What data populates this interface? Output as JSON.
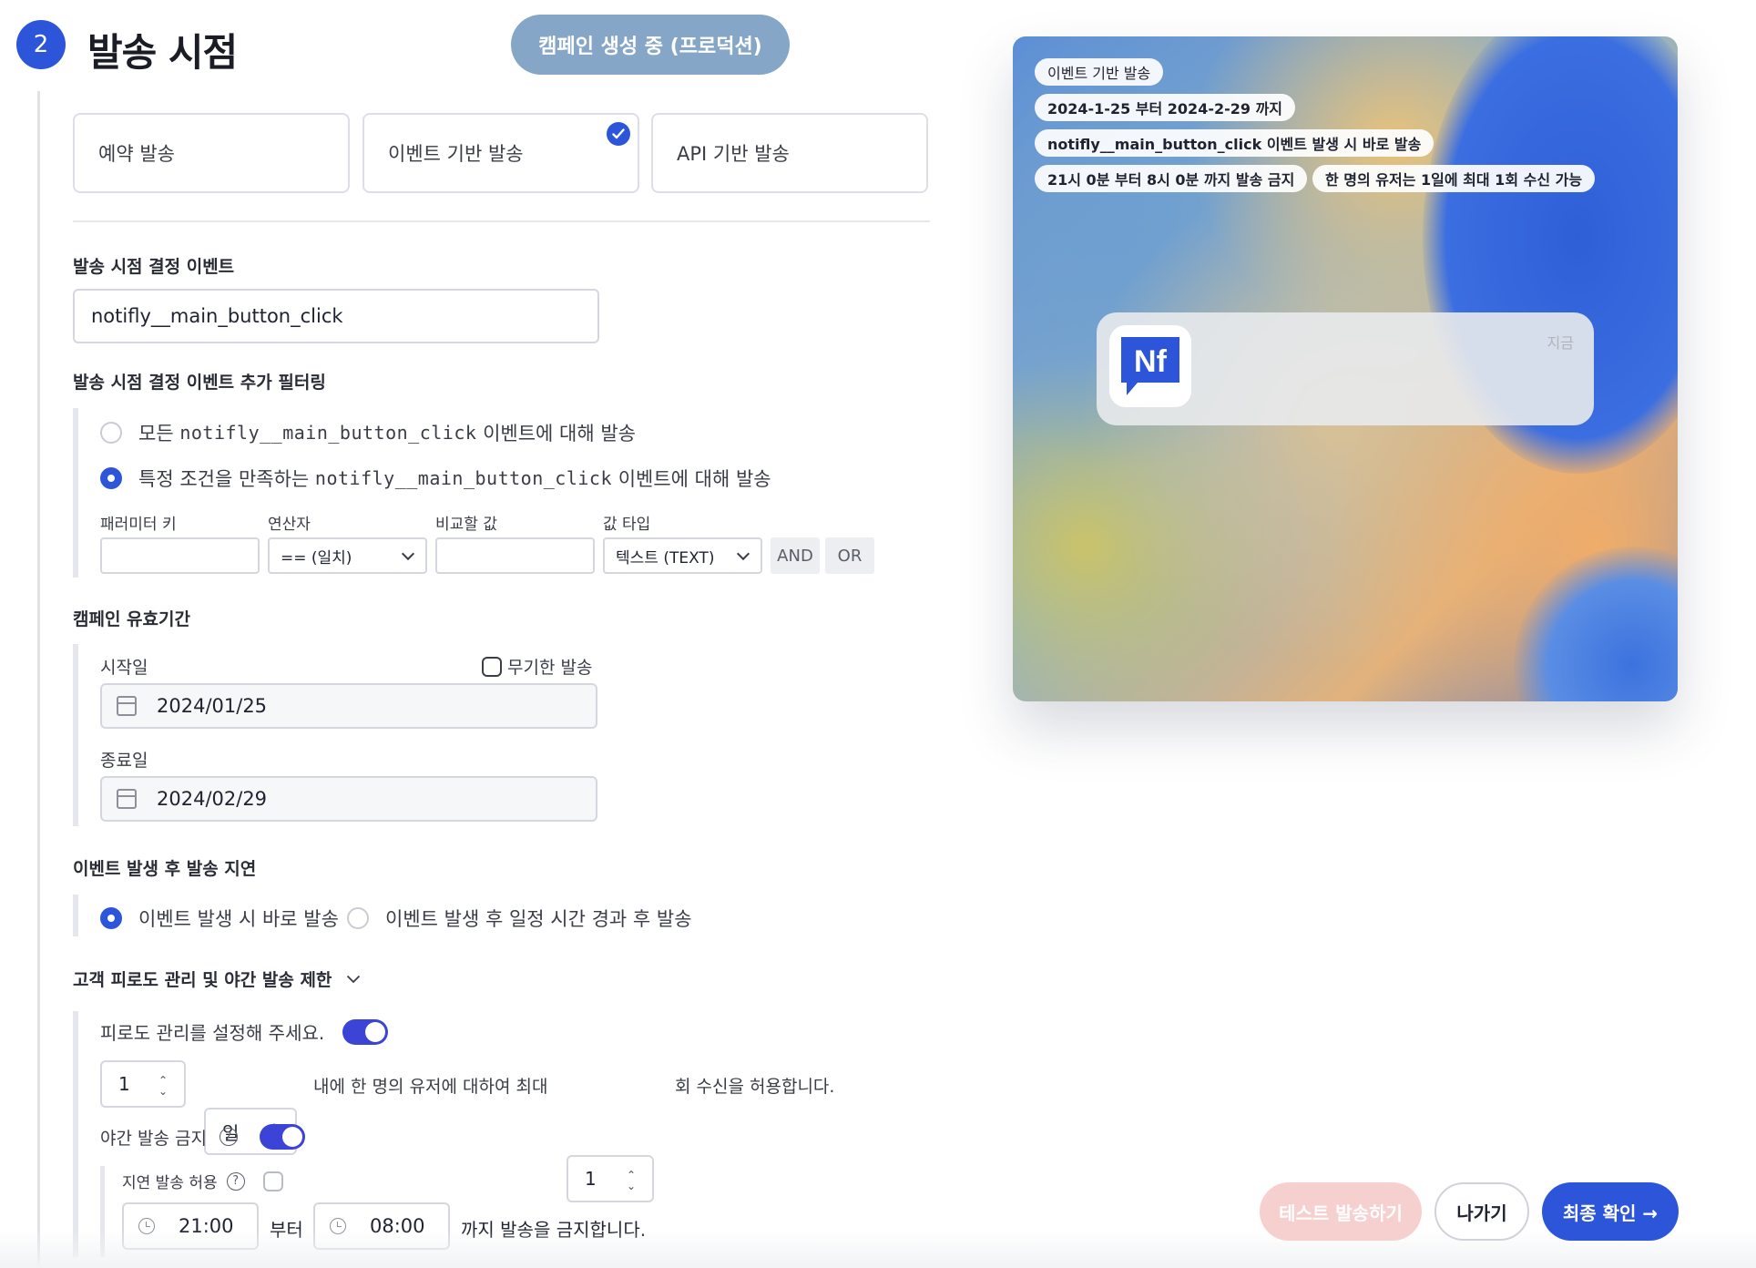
{
  "header": {
    "step_number": "2",
    "title": "발송 시점",
    "status_pill": "캠페인 생성 중 (프로덕션)"
  },
  "methods": [
    {
      "label": "예약 발송",
      "selected": false
    },
    {
      "label": "이벤트 기반 발송",
      "selected": true
    },
    {
      "label": "API 기반 발송",
      "selected": false
    }
  ],
  "event_section": {
    "title": "발송 시점 결정 이벤트",
    "event_value": "notifly__main_button_click"
  },
  "filter_section": {
    "title": "발송 시점 결정 이벤트 추가 필터링",
    "option_all_prefix": "모든",
    "option_all_code": "notifly__main_button_click",
    "option_all_suffix": "이벤트에 대해 발송",
    "option_cond_prefix": "특정 조건을 만족하는",
    "option_cond_code": "notifly__main_button_click",
    "option_cond_suffix": "이벤트에 대해 발송",
    "labels": {
      "param_key": "패러미터 키",
      "operator": "연산자",
      "compare_value": "비교할 값",
      "value_type": "값 타입"
    },
    "param_key_value": "",
    "operator_value": "== (일치)",
    "compare_value": "",
    "value_type_value": "텍스트 (TEXT)",
    "and_label": "AND",
    "or_label": "OR"
  },
  "validity_section": {
    "title": "캠페인 유효기간",
    "start_label": "시작일",
    "unlimited_label": "무기한 발송",
    "start_value": "2024/01/25",
    "end_label": "종료일",
    "end_value": "2024/02/29"
  },
  "delay_section": {
    "title": "이벤트 발생 후 발송 지연",
    "option_immediate": "이벤트 발생 시 바로 발송",
    "option_delayed": "이벤트 발생 후 일정 시간 경과 후 발송"
  },
  "fatigue_section": {
    "title": "고객 피로도 관리 및 야간 발송 제한",
    "fatigue_label": "피로도 관리를 설정해 주세요.",
    "period_value": "1",
    "unit_value": "일",
    "middle_text": "내에 한 명의 유저에 대하여 최대",
    "count_value": "1",
    "end_text": "회 수신을 허용합니다.",
    "night_label": "야간 발송 금지",
    "delay_allow_label": "지연 발송 허용",
    "night_start": "21:00",
    "from_text": "부터",
    "night_end": "08:00",
    "until_text": "까지 발송을 금지합니다."
  },
  "preview": {
    "tags": [
      "이벤트 기반 발송",
      "2024-1-25 부터 2024-2-29 까지",
      "notifly__main_button_click 이벤트 발생 시 바로 발송",
      "21시 0분 부터 8시 0분 까지 발송 금지",
      "한 명의 유저는 1일에 최대 1회 수신 가능"
    ],
    "app_icon_text": "Nf",
    "notification_time": "지금"
  },
  "footer": {
    "test_button": "테스트 발송하기",
    "exit_button": "나가기",
    "confirm_button": "최종 확인 →"
  },
  "colors": {
    "primary": "#2c55d9",
    "toggle": "#3b44d6",
    "status_pill": "#86a6c7",
    "test_button": "#f6cfcf"
  }
}
